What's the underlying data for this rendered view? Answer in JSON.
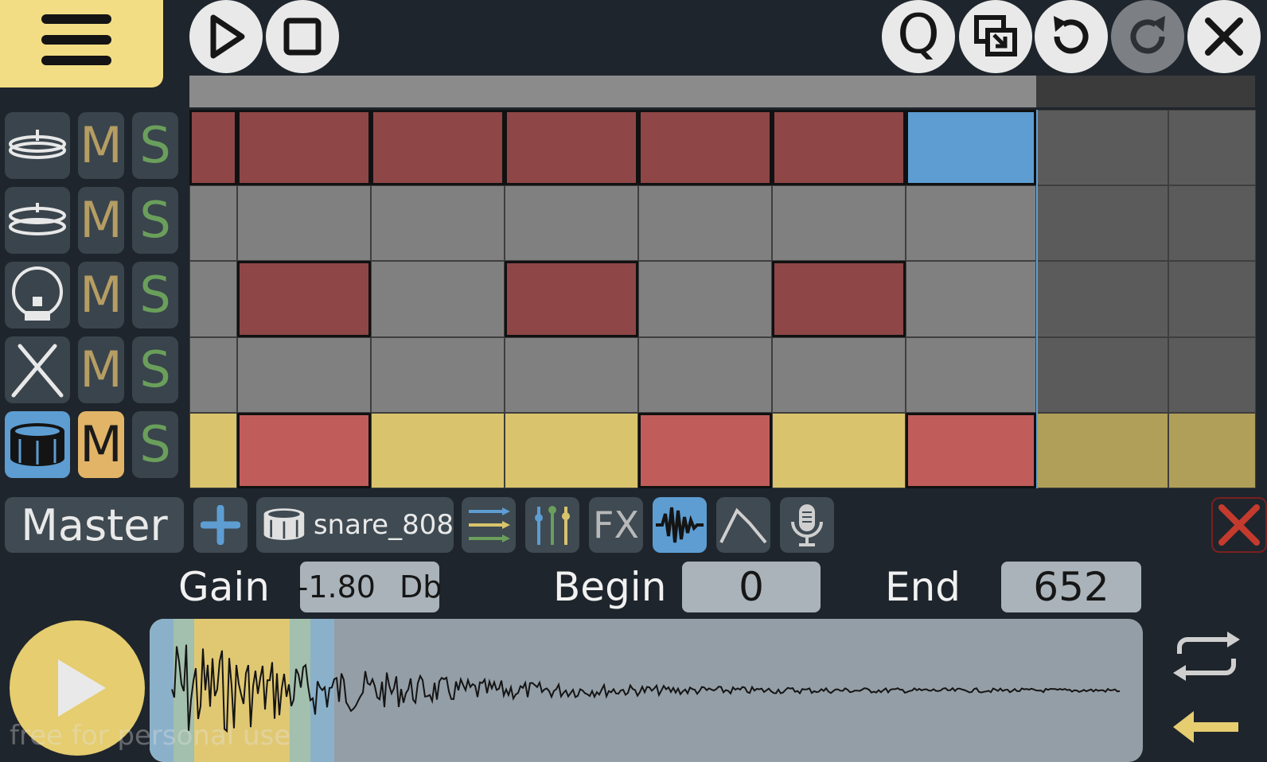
{
  "toolbar": {
    "menu_icon": "hamburger-icon",
    "play_icon": "play-icon",
    "stop_icon": "stop-icon",
    "quantize_label": "Q",
    "icons": [
      "quantize-icon",
      "copy-paste-icon",
      "undo-icon",
      "redo-icon",
      "close-icon"
    ]
  },
  "tracks": [
    {
      "icon": "hihat-closed-icon",
      "mute": "M",
      "solo": "S",
      "active": false
    },
    {
      "icon": "hihat-open-icon",
      "mute": "M",
      "solo": "S",
      "active": false
    },
    {
      "icon": "kick-drum-icon",
      "mute": "M",
      "solo": "S",
      "active": false
    },
    {
      "icon": "drumsticks-icon",
      "mute": "M",
      "solo": "S",
      "active": false
    },
    {
      "icon": "snare-drum-icon",
      "mute": "M",
      "solo": "S",
      "active": true
    }
  ],
  "pattern": {
    "rows": [
      [
        1,
        1,
        1,
        1,
        1,
        1,
        2,
        0,
        0
      ],
      [
        0,
        0,
        0,
        0,
        0,
        0,
        0,
        0,
        0
      ],
      [
        0,
        1,
        0,
        1,
        0,
        1,
        0,
        0,
        0
      ],
      [
        0,
        0,
        0,
        0,
        0,
        0,
        0,
        0,
        0
      ],
      [
        0,
        1,
        0,
        0,
        1,
        0,
        1,
        0,
        0
      ]
    ],
    "selected_row": 4
  },
  "instrument_bar": {
    "master_label": "Master",
    "add_icon": "plus-icon",
    "sample_icon": "snare-drum-icon",
    "sample_name": "snare_808",
    "fx_label": "FX",
    "tabs": [
      "sequence-icon",
      "mixer-icon",
      "fx",
      "waveform-icon",
      "envelope-icon",
      "microphone-icon"
    ],
    "active_tab": "waveform-icon",
    "delete_icon": "close-x-icon"
  },
  "sample_editor": {
    "gain_label": "Gain",
    "gain_value": "-1.80",
    "gain_unit": "Db",
    "begin_label": "Begin",
    "begin_value": "0",
    "end_label": "End",
    "end_value": "652",
    "loop_icon": "loop-icon",
    "back_icon": "arrow-left-icon",
    "play_icon": "play-icon"
  },
  "watermark": "free for personal use",
  "colors": {
    "background": "#1f252c",
    "accent_yellow": "#f2dd84",
    "note_red": "#8e4647",
    "note_red_selected_row": "#c05d5b",
    "cell_gray": "#808080",
    "cell_dark": "#5b5b5b",
    "selected_row_yellow": "#d9c46d",
    "highlight_blue": "#5d9dd2"
  }
}
